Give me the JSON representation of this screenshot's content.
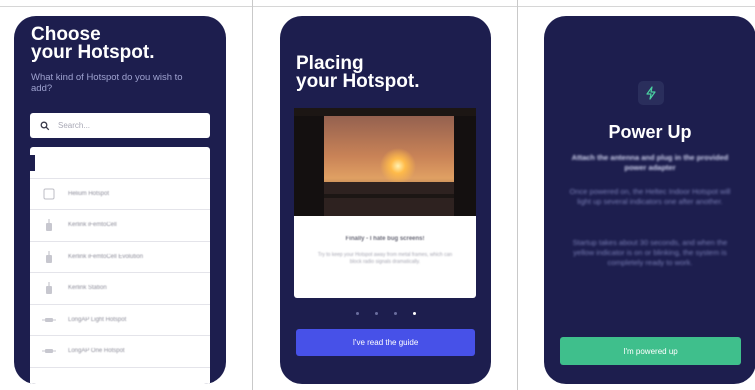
{
  "screen1": {
    "title_line1": "Choose",
    "title_line2": "your Hotspot.",
    "subtitle": "What kind of Hotspot do you wish to add?",
    "search": {
      "placeholder": "Search..."
    },
    "items": [
      {
        "label": "",
        "icon": "blank-icon"
      },
      {
        "label": "Helium Hotspot",
        "icon": "square-icon"
      },
      {
        "label": "Kerlink iFemtoCell",
        "icon": "antenna-icon"
      },
      {
        "label": "Kerlink iFemtoCell Evolution",
        "icon": "antenna-icon"
      },
      {
        "label": "Kerlink Station",
        "icon": "antenna-icon"
      },
      {
        "label": "LongAP Light Hotspot",
        "icon": "device-icon"
      },
      {
        "label": "LongAP One Hotspot",
        "icon": "device-icon"
      }
    ]
  },
  "screen2": {
    "title_line1": "Placing",
    "title_line2": "your Hotspot.",
    "card_title": "Finally - I hate bug screens!",
    "card_body": "Try to keep your Hotspot away from metal frames, which can block radio signals dramatically.",
    "pagination": {
      "count": 4,
      "active": 3
    },
    "button_label": "I've read the guide"
  },
  "screen3": {
    "icon": "bolt-icon",
    "title": "Power Up",
    "bold_text": "Attach the antenna and plug in the provided power adapter",
    "text1": "Once powered on, the Heltec Indoor Hotspot will light up several indicators one after another.",
    "text2": "Startup takes about 30 seconds, and when the yellow indicator is on or blinking, the system is completely ready to work.",
    "button_label": "I'm powered up"
  },
  "colors": {
    "background": "#1d1e4e",
    "primary_button": "#4751e8",
    "success_button": "#3fbf8c"
  }
}
